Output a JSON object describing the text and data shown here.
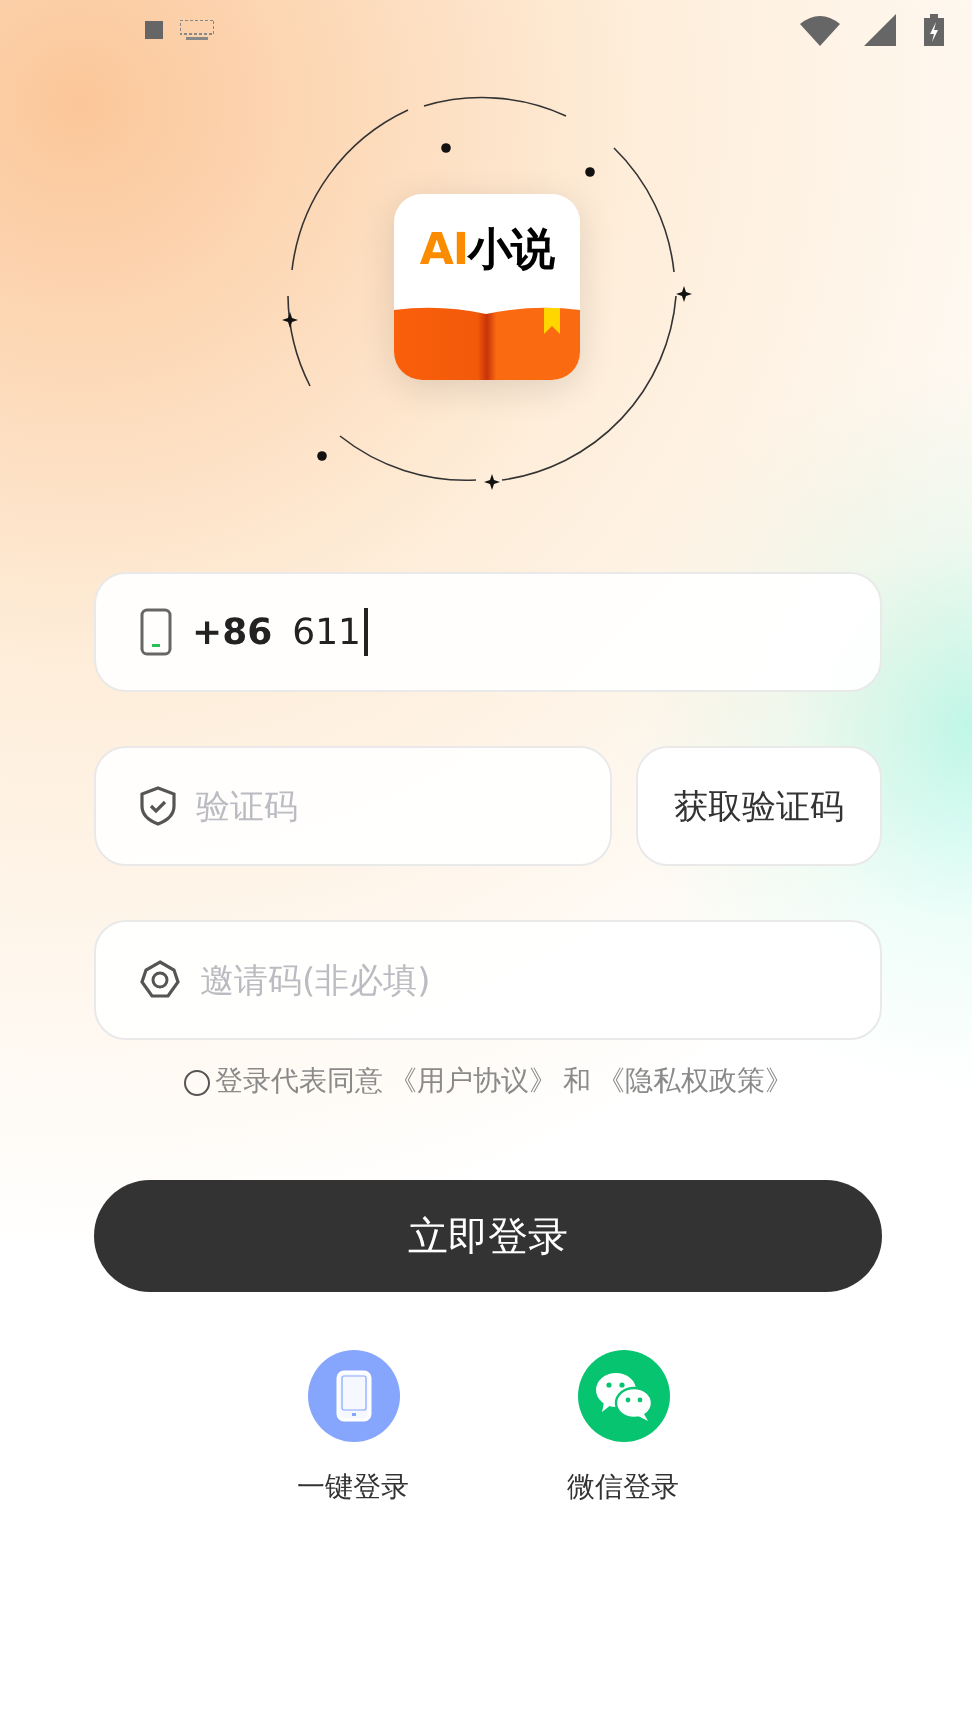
{
  "logo": {
    "prefix": "AI",
    "title": "小说"
  },
  "phone_field": {
    "country_code": "+86",
    "value": "611"
  },
  "code_field": {
    "placeholder": "验证码"
  },
  "get_code_button": "获取验证码",
  "invite_field": {
    "placeholder": "邀请码(非必填)"
  },
  "agreement": {
    "checked": false,
    "text": "登录代表同意",
    "links": [
      "《用户协议》",
      "《隐私权政策》"
    ],
    "joiner": "和"
  },
  "login_button": "立即登录",
  "quick_logins": [
    {
      "kind": "phone",
      "label": "一键登录",
      "color": "#86a6fd"
    },
    {
      "kind": "wechat",
      "label": "微信登录",
      "color": "#07c470"
    }
  ]
}
